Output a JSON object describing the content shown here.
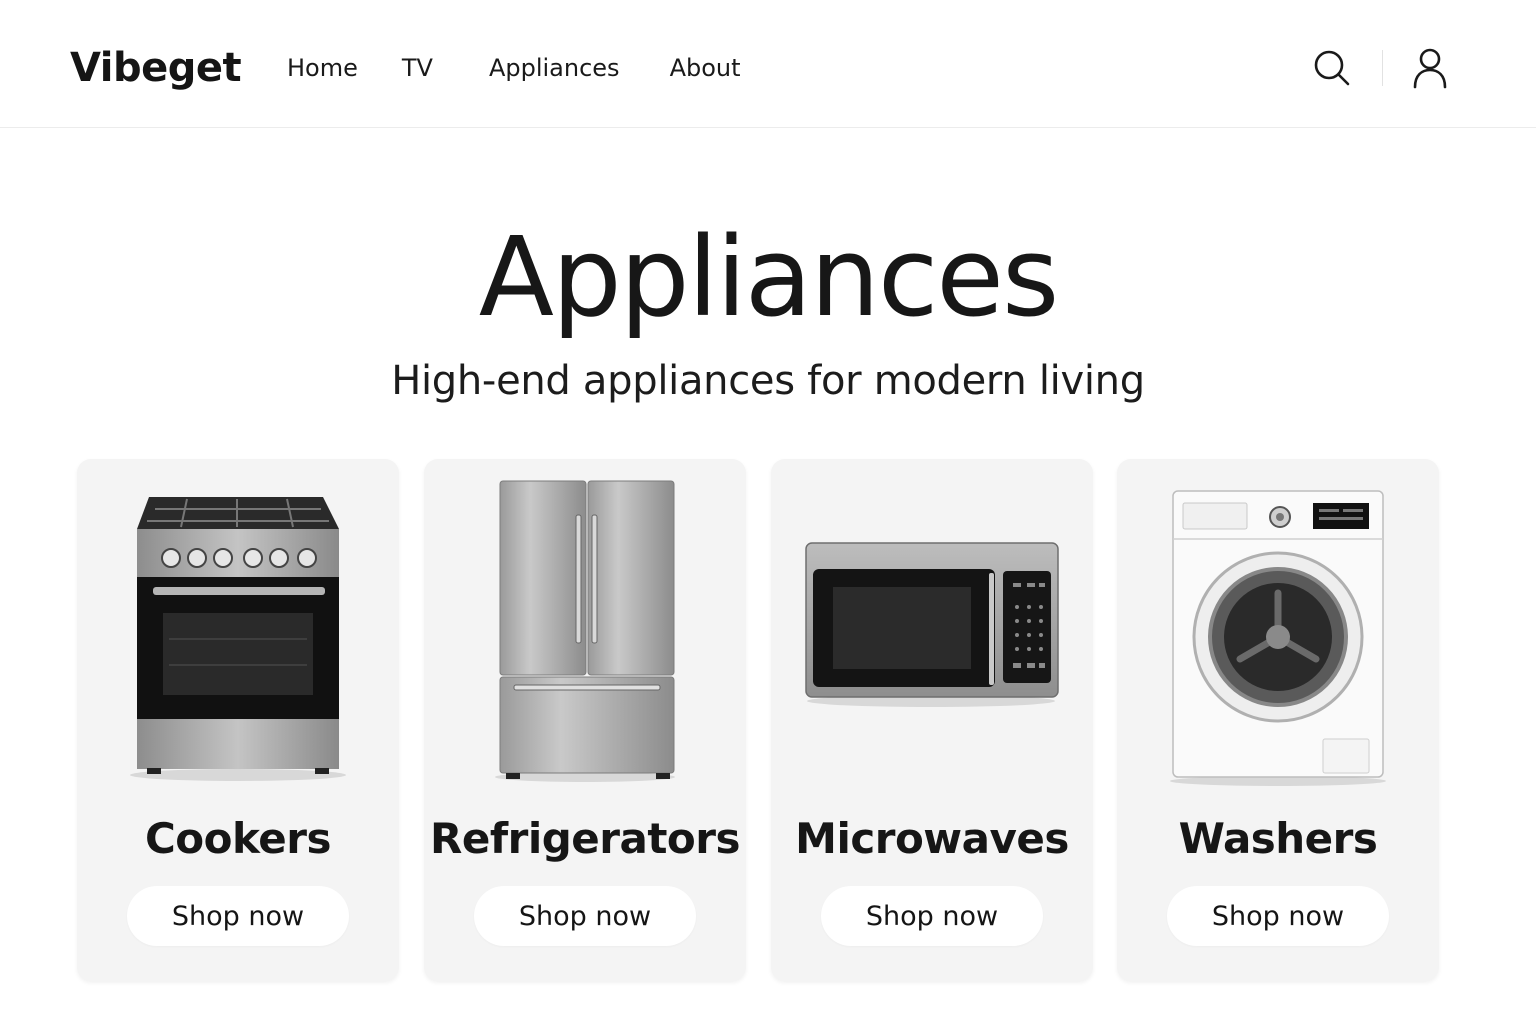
{
  "brand": {
    "name": "Vibeget"
  },
  "nav": {
    "items": [
      {
        "label": "Home"
      },
      {
        "label": "TV"
      },
      {
        "label": "Appliances"
      },
      {
        "label": "About"
      }
    ]
  },
  "header_icons": [
    "search-icon",
    "user-icon"
  ],
  "hero": {
    "title": "Appliances",
    "subtitle": "High-end appliances for modern living"
  },
  "categories": [
    {
      "name": "Cookers",
      "button_label": "Shop now",
      "image": "cooker-image"
    },
    {
      "name": "Refrigerators",
      "button_label": "Shop now",
      "image": "refrigerator-image"
    },
    {
      "name": "Microwaves",
      "button_label": "Shop now",
      "image": "microwave-image"
    },
    {
      "name": "Washers",
      "button_label": "Shop now",
      "image": "washer-image"
    }
  ]
}
